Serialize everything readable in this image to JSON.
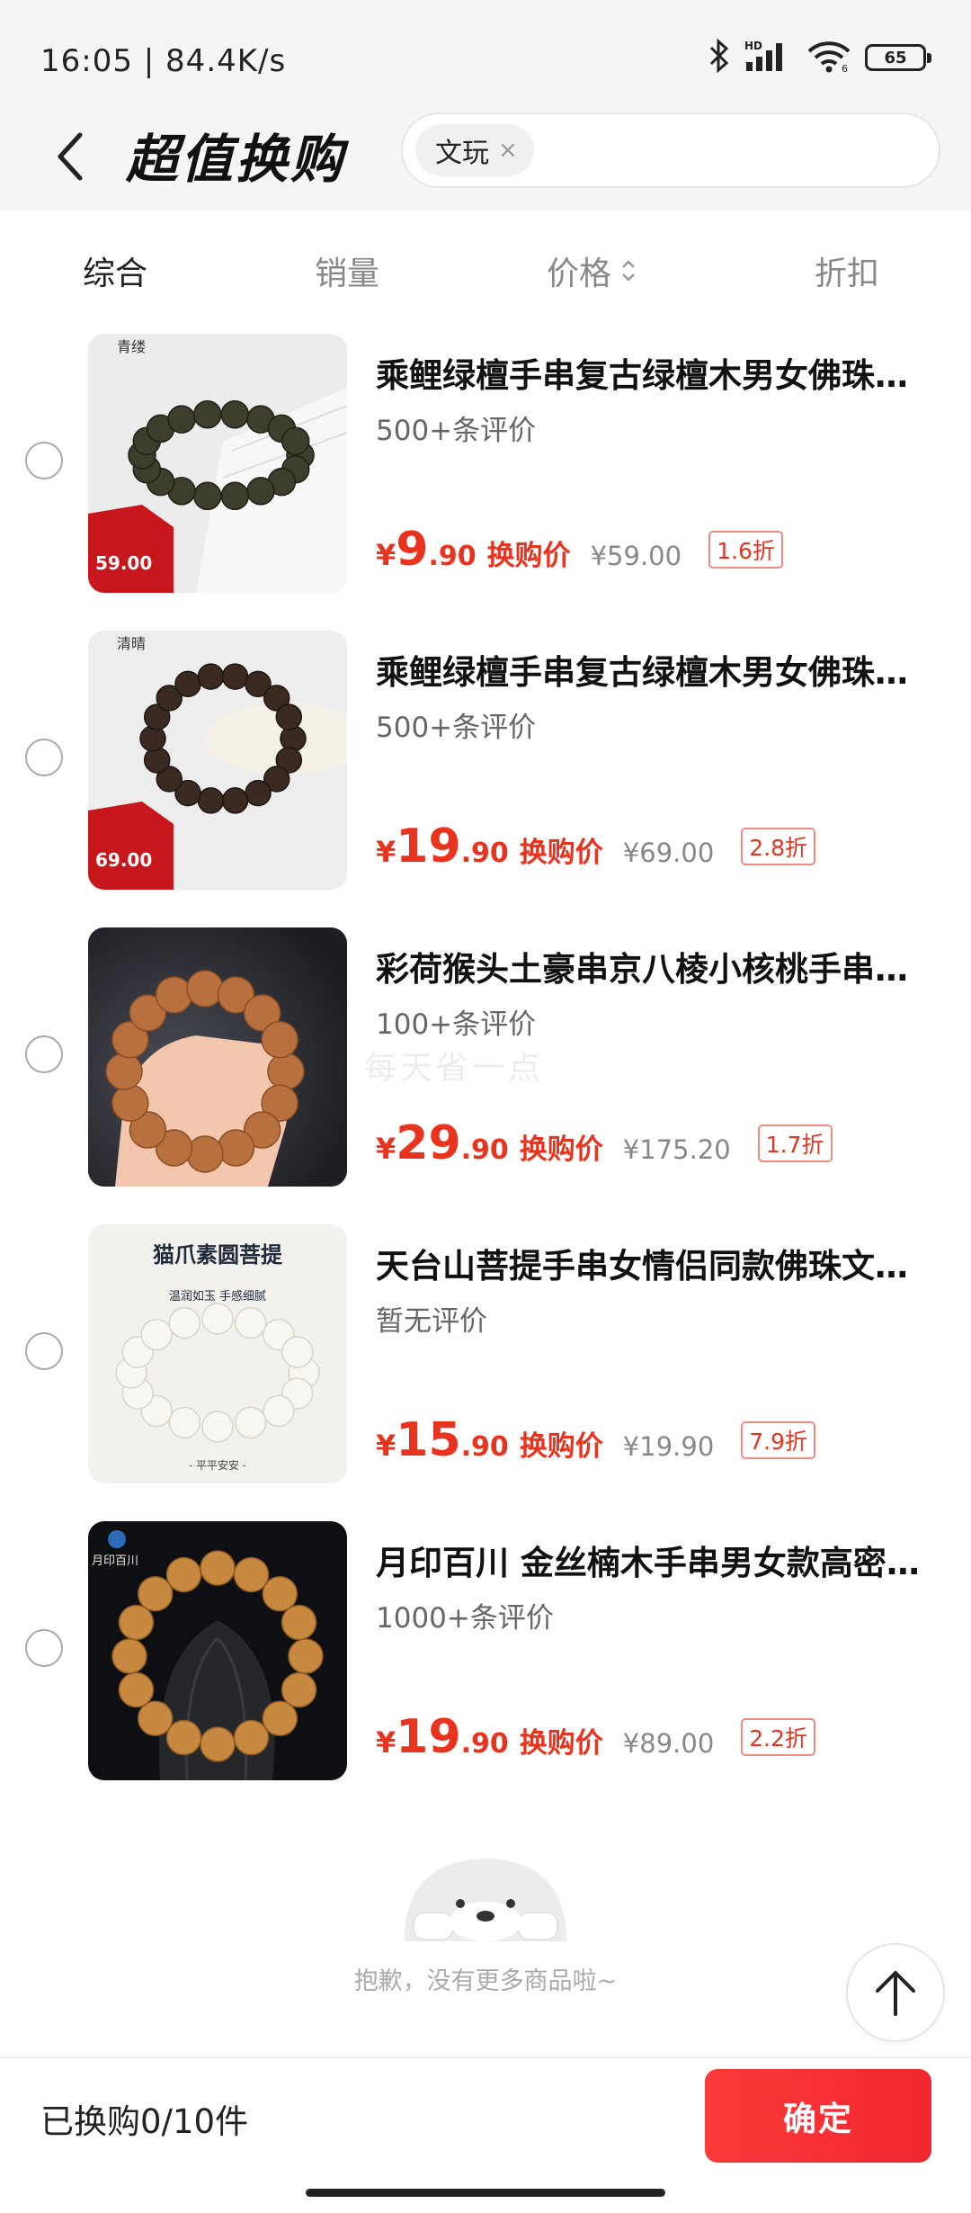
{
  "status_bar": {
    "time": "16:05 | 84.4K/s",
    "battery": "65",
    "icons": [
      "bluetooth-icon",
      "hd-signal-icon",
      "wifi-icon",
      "battery-icon"
    ]
  },
  "header": {
    "title": "超值换购",
    "search_tag": "文玩",
    "tag_close": "×"
  },
  "sort_tabs": {
    "comprehensive": "综合",
    "sales": "销量",
    "price": "价格",
    "discount": "折扣"
  },
  "products": [
    {
      "title": "乘鲤绿檀手串复古绿檀木男女佛珠手串",
      "reviews": "500+条评价",
      "yen": "¥",
      "price_int": "9",
      "price_dec": ".90",
      "price_label": "换购价",
      "original_price": "¥59.00",
      "discount": "1.6折",
      "thumb_text": "青缕",
      "thumb_badge": "59.00"
    },
    {
      "title": "乘鲤绿檀手串复古绿檀木男女佛珠手串",
      "reviews": "500+条评价",
      "yen": "¥",
      "price_int": "19",
      "price_dec": ".90",
      "price_label": "换购价",
      "original_price": "¥69.00",
      "discount": "2.8折",
      "thumb_text": "清晴",
      "thumb_badge": "69.00"
    },
    {
      "title": "彩荷猴头土豪串京八棱小核桃手串文玩",
      "reviews": "100+条评价",
      "yen": "¥",
      "price_int": "29",
      "price_dec": ".90",
      "price_label": "换购价",
      "original_price": "¥175.20",
      "discount": "1.7折"
    },
    {
      "title": "天台山菩提手串女情侣同款佛珠文玩手串",
      "reviews": "暂无评价",
      "yen": "¥",
      "price_int": "15",
      "price_dec": ".90",
      "price_label": "换购价",
      "original_price": "¥19.90",
      "discount": "7.9折",
      "thumb_title": "猫爪素圆菩提",
      "thumb_sub": "温润如玉 手感细腻",
      "thumb_foot": "- 平平安安 -"
    },
    {
      "title": "月印百川 金丝楠木手串男女款高密度手串",
      "reviews": "1000+条评价",
      "yen": "¥",
      "price_int": "19",
      "price_dec": ".90",
      "price_label": "换购价",
      "original_price": "¥89.00",
      "discount": "2.2折",
      "thumb_text": "月印百川"
    }
  ],
  "watermark": "每天省一点",
  "end_of_list": "抱歉，没有更多商品啦~",
  "bottom_bar": {
    "exchanged": "已换购0/10件",
    "confirm": "确定"
  },
  "colors": {
    "accent_red": "#e8331f",
    "button_red": "#f2272f",
    "background_gray": "#f5f5f5"
  }
}
